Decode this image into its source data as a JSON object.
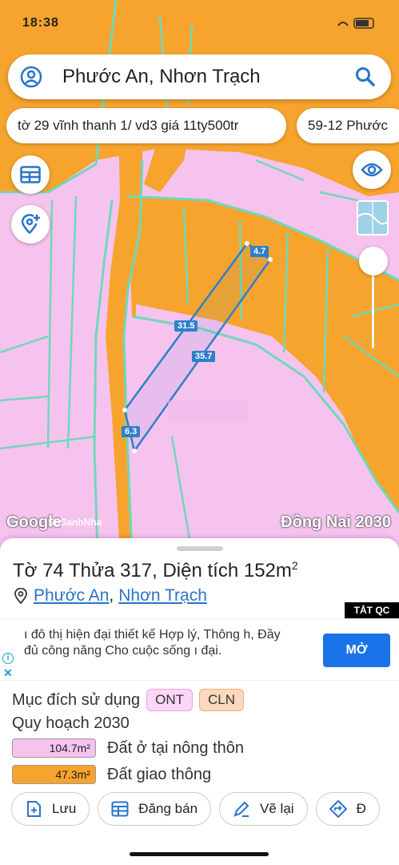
{
  "status": {
    "time": "18:38"
  },
  "search": {
    "text": "Phước An, Nhơn Trạch"
  },
  "chips": [
    {
      "label": "tờ 29 vĩnh thanh 1/ vd3 giá 11ty500tr"
    },
    {
      "label": "59-12 Phước"
    }
  ],
  "map": {
    "dimensions": [
      "4.7",
      "31.5",
      "35.7",
      "6.3"
    ],
    "google_logo": "Google",
    "watermark": "SoSanhNha",
    "layer_label": "Đồng Nai 2030",
    "colors": {
      "residential": "#f6c3ef",
      "road": "#f6a42d",
      "boundary": "#5fd4b0",
      "parcel": "#2f80c9"
    }
  },
  "parcel": {
    "title": "Tờ 74 Thửa 317, Diện tích 152m",
    "title_sup": "2",
    "ward": "Phước An",
    "district": "Nhơn Trạch",
    "separator": ","
  },
  "ad": {
    "close_label": "TẮT QC",
    "text": "ı đô thị hiện đại thiết kế Hợp lý, Thông h, Đầy đủ công năng Cho cuộc sống ı đại.",
    "button": "MỞ"
  },
  "usage": {
    "label": "Mục đích sử dụng",
    "tags": [
      "ONT",
      "CLN"
    ]
  },
  "planning": {
    "label": "Quy hoạch 2030",
    "areas": [
      {
        "value": "104.7m²",
        "name": "Đất ở tại nông thôn"
      },
      {
        "value": "47.3m²",
        "name": "Đất giao thông"
      }
    ]
  },
  "actions": [
    {
      "label": "Lưu",
      "icon": "add-bookmark-icon"
    },
    {
      "label": "Đăng bán",
      "icon": "listing-icon"
    },
    {
      "label": "Vẽ lại",
      "icon": "redraw-icon"
    },
    {
      "label": "Đ",
      "icon": "directions-icon"
    }
  ]
}
